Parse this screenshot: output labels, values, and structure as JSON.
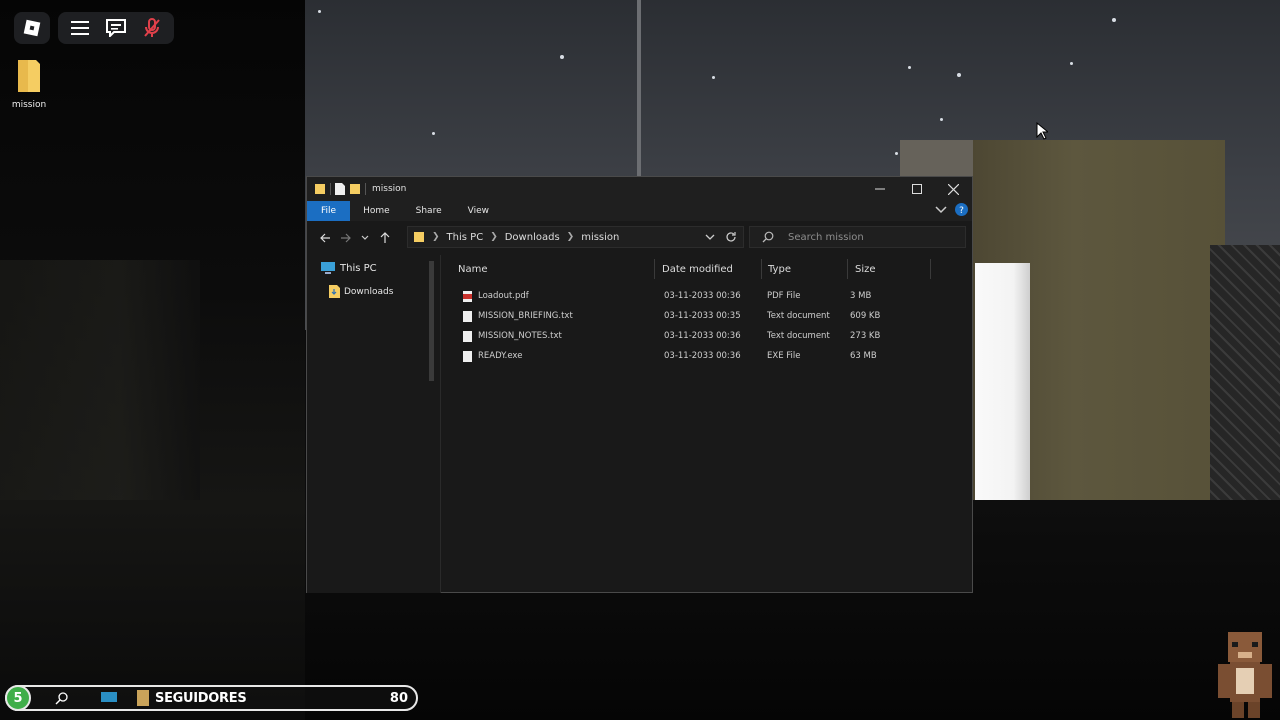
{
  "desktop": {
    "icon_label": "mission"
  },
  "window": {
    "title": "mission",
    "ribbon_tabs": [
      "File",
      "Home",
      "Share",
      "View"
    ],
    "breadcrumb": [
      "This PC",
      "Downloads",
      "mission"
    ],
    "search_placeholder": "Search mission",
    "nav_items": [
      "This PC",
      "Downloads"
    ],
    "columns": [
      "Name",
      "Date modified",
      "Type",
      "Size"
    ],
    "files": [
      {
        "name": "Loadout.pdf",
        "date": "03-11-2033 00:36",
        "type": "PDF File",
        "size": "3 MB",
        "icon": "pdf"
      },
      {
        "name": "MISSION_BRIEFING.txt",
        "date": "03-11-2033 00:35",
        "type": "Text document",
        "size": "609 KB",
        "icon": "txt"
      },
      {
        "name": "MISSION_NOTES.txt",
        "date": "03-11-2033 00:36",
        "type": "Text document",
        "size": "273 KB",
        "icon": "txt"
      },
      {
        "name": "READY.exe",
        "date": "03-11-2033 00:36",
        "type": "EXE File",
        "size": "63 MB",
        "icon": "exe"
      }
    ]
  },
  "bottombar": {
    "level": "5",
    "label": "SEGUIDORES",
    "count": "80"
  },
  "colors": {
    "accent": "#1b6ec2",
    "badge": "#3fae49",
    "folder": "#f5cd62"
  }
}
